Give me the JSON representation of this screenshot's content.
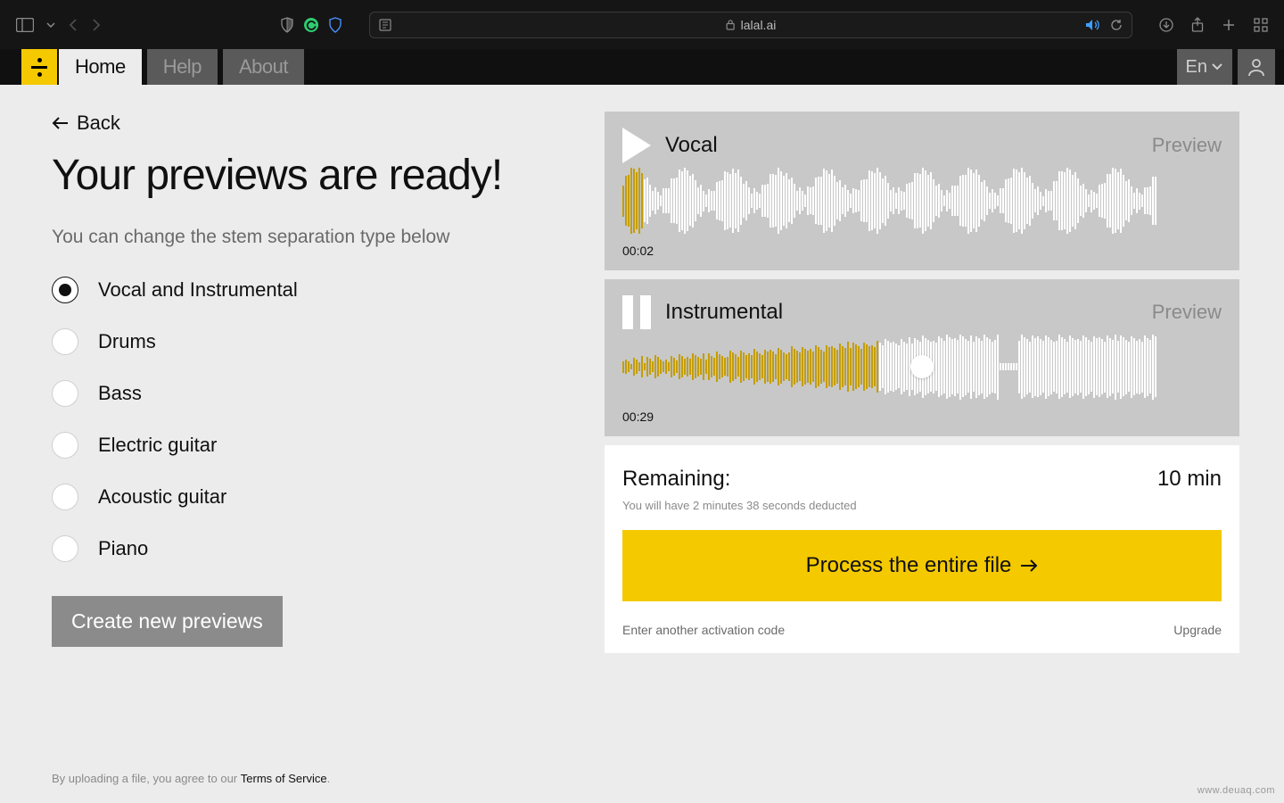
{
  "browser": {
    "url_host": "lalal.ai"
  },
  "nav": {
    "tabs": [
      "Home",
      "Help",
      "About"
    ],
    "active_index": 0,
    "lang": "En"
  },
  "page": {
    "back_label": "Back",
    "headline": "Your previews are ready!",
    "subtext": "You can change the stem separation type below",
    "stems": [
      {
        "label": "Vocal and Instrumental",
        "selected": true
      },
      {
        "label": "Drums",
        "selected": false
      },
      {
        "label": "Bass",
        "selected": false
      },
      {
        "label": "Electric guitar",
        "selected": false
      },
      {
        "label": "Acoustic guitar",
        "selected": false
      },
      {
        "label": "Piano",
        "selected": false
      }
    ],
    "create_button": "Create new previews",
    "tos_prefix": "By uploading a file, you agree to our ",
    "tos_link": "Terms of Service",
    "tos_suffix": "."
  },
  "tracks": [
    {
      "title": "Vocal",
      "tag": "Preview",
      "time": "00:02",
      "state": "play",
      "progress": 0.04
    },
    {
      "title": "Instrumental",
      "tag": "Preview",
      "time": "00:29",
      "state": "pause",
      "progress": 0.48
    }
  ],
  "panel": {
    "remaining_label": "Remaining:",
    "remaining_value": "10 min",
    "deduct_note": "You will have 2 minutes 38 seconds deducted",
    "process_button": "Process the entire file",
    "footer_left": "Enter another activation code",
    "footer_right": "Upgrade"
  },
  "watermark": "www.deuaq.com"
}
